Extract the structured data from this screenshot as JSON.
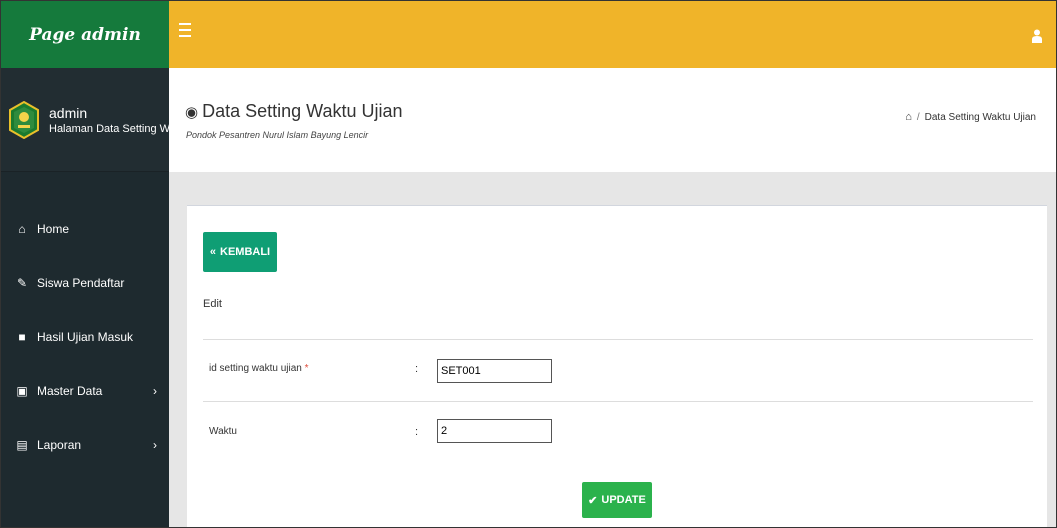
{
  "brand": {
    "title": "Page admin"
  },
  "user": {
    "name": "admin",
    "subtitle": "Halaman Data Setting Waktu Ujian"
  },
  "sidebar": {
    "items": [
      {
        "label": "Home",
        "icon": "home-icon"
      },
      {
        "label": "Siswa Pendaftar",
        "icon": "pencil-icon"
      },
      {
        "label": "Hasil Ujian Masuk",
        "icon": "book-icon"
      },
      {
        "label": "Master Data",
        "icon": "edit-icon",
        "has_children": true
      },
      {
        "label": "Laporan",
        "icon": "calendar-icon",
        "has_children": true
      }
    ]
  },
  "header": {
    "title": "Data Setting Waktu Ujian",
    "subtitle": "Pondok Pesantren Nurul Islam Bayung Lencir",
    "breadcrumb": {
      "separator": "/",
      "current": "Data Setting Waktu Ujian"
    }
  },
  "form": {
    "back_label": "KEMBALI",
    "section_label": "Edit",
    "fields": [
      {
        "label": "id setting waktu ujian",
        "required_mark": "*",
        "value": "SET001"
      },
      {
        "label": "Waktu",
        "value": "2"
      }
    ],
    "colon": ":",
    "update_label": "UPDATE"
  },
  "colors": {
    "brand": "#157a3c",
    "topbar": "#f0b429",
    "sidebar": "#222d32",
    "back_button": "#0f9e74",
    "update_button": "#2bb24c"
  }
}
